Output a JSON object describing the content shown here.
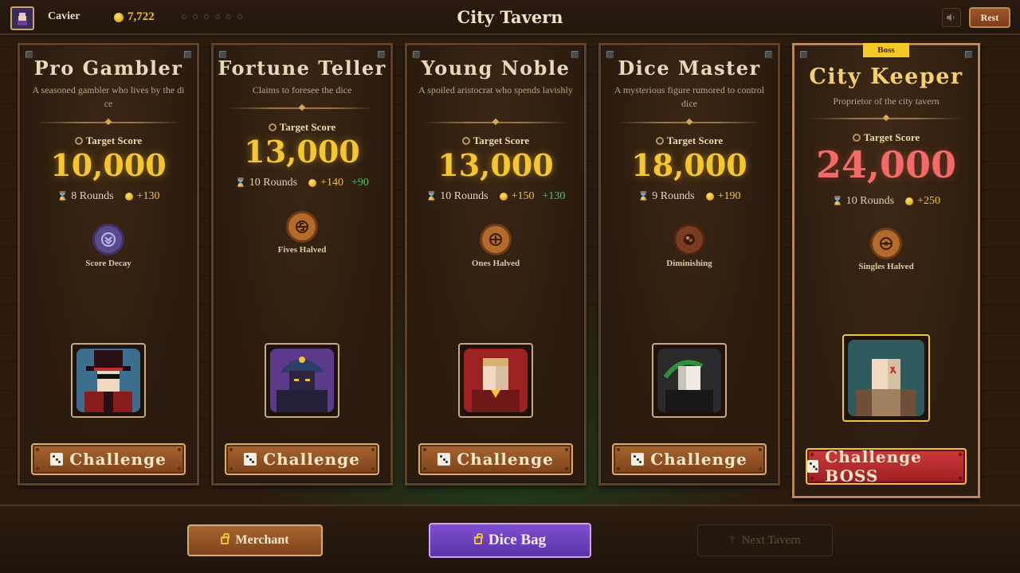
{
  "header": {
    "player_name": "Cavier",
    "gold": "7,722",
    "title": "City Tavern",
    "rest_label": "Rest",
    "sound_icon": "speaker-icon"
  },
  "opponents": [
    {
      "name": "Pro Gambler",
      "description": "A seasoned gambler who lives by the dice",
      "target_label": "Target Score",
      "target_score": "10,000",
      "rounds": "8 Rounds",
      "gold_bonus": "+130",
      "extra_bonus": "",
      "modifier": "Score Decay",
      "button": "Challenge",
      "boss": false
    },
    {
      "name": "Fortune Teller",
      "description": "Claims to foresee the dice",
      "target_label": "Target Score",
      "target_score": "13,000",
      "rounds": "10 Rounds",
      "gold_bonus": "+140",
      "extra_bonus": "+90",
      "modifier": "Fives Halved",
      "button": "Challenge",
      "boss": false
    },
    {
      "name": "Young Noble",
      "description": "A spoiled aristocrat who spends lavishly",
      "target_label": "Target Score",
      "target_score": "13,000",
      "rounds": "10 Rounds",
      "gold_bonus": "+150",
      "extra_bonus": "+130",
      "modifier": "Ones Halved",
      "button": "Challenge",
      "boss": false
    },
    {
      "name": "Dice Master",
      "description": "A mysterious figure rumored to control dice",
      "target_label": "Target Score",
      "target_score": "18,000",
      "rounds": "9 Rounds",
      "gold_bonus": "+190",
      "extra_bonus": "",
      "modifier": "Diminishing",
      "button": "Challenge",
      "boss": false
    },
    {
      "name": "City Keeper",
      "description": "Proprietor of the city tavern",
      "target_label": "Target Score",
      "target_score": "24,000",
      "rounds": "10 Rounds",
      "gold_bonus": "+250",
      "extra_bonus": "",
      "modifier": "Singles Halved",
      "button": "Challenge BOSS",
      "boss": true,
      "boss_tag": "Boss"
    }
  ],
  "footer": {
    "merchant_label": "Merchant",
    "dice_bag_label": "Dice Bag",
    "next_tavern_label": "Next Tavern"
  },
  "colors": {
    "gold": "#f6c62d",
    "boss_score": "#f46a66",
    "bonus_green": "#4cc36a",
    "dice_bag": "#7f4fd1"
  }
}
